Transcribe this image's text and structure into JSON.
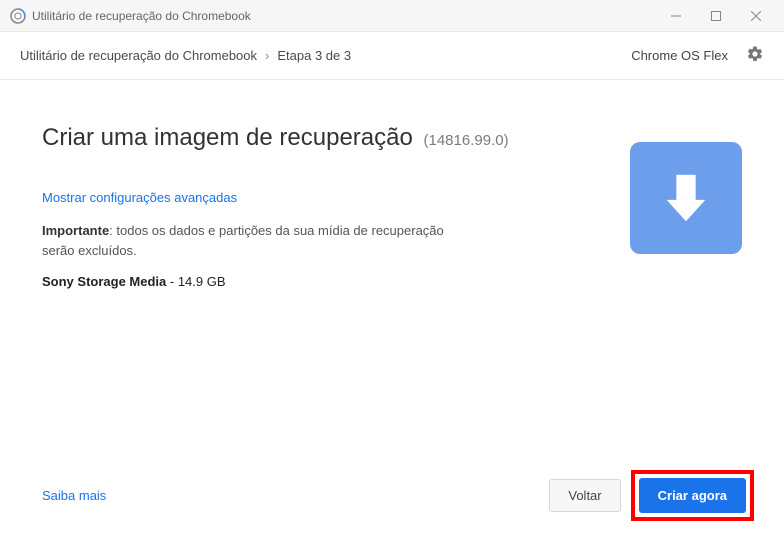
{
  "titlebar": {
    "title": "Utilitário de recuperação do Chromebook"
  },
  "header": {
    "breadcrumb_app": "Utilitário de recuperação do Chromebook",
    "breadcrumb_step": "Etapa 3 de 3",
    "os_name": "Chrome OS Flex"
  },
  "main": {
    "heading": "Criar uma imagem de recuperação",
    "version": "(14816.99.0)",
    "advanced_link": "Mostrar configurações avançadas",
    "warning_bold": "Importante",
    "warning_text": ": todos os dados e partições da sua mídia de recuperação serão excluídos.",
    "media_name": "Sony Storage Media",
    "media_sep": " - ",
    "media_size": "14.9 GB"
  },
  "footer": {
    "learn_more": "Saiba mais",
    "back": "Voltar",
    "create": "Criar agora"
  }
}
